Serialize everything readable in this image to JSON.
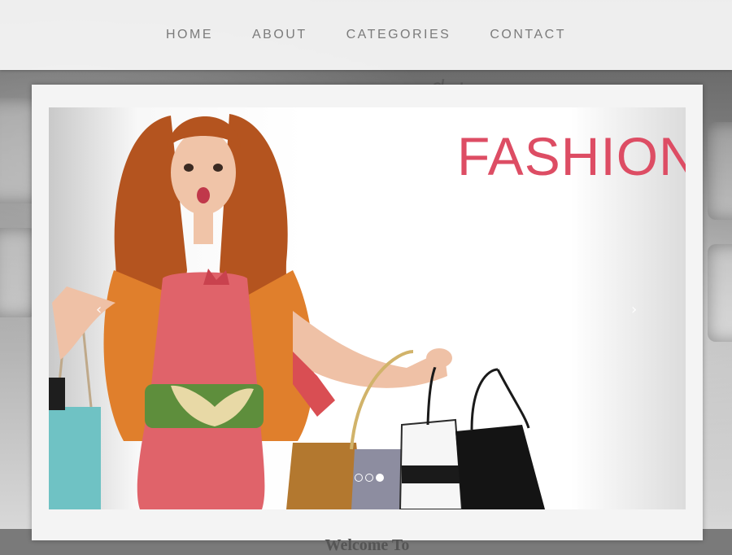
{
  "nav": {
    "items": [
      {
        "label": "HOME"
      },
      {
        "label": "ABOUT"
      },
      {
        "label": "CATEGORIES"
      },
      {
        "label": "CONTACT"
      }
    ]
  },
  "background": {
    "key_label": "del"
  },
  "carousel": {
    "slide_title": "FASHION",
    "prev_glyph": "‹",
    "next_glyph": "›",
    "slide_count": 3,
    "active_slide": 3
  },
  "welcome": {
    "heading": "Welcome To"
  },
  "colors": {
    "nav_text": "#7b7b7b",
    "fashion_title": "#dd4d64",
    "dress": "#e0636a",
    "jacket": "#e07f2c",
    "hair": "#b4541f",
    "belt": "#5e8e3c"
  }
}
